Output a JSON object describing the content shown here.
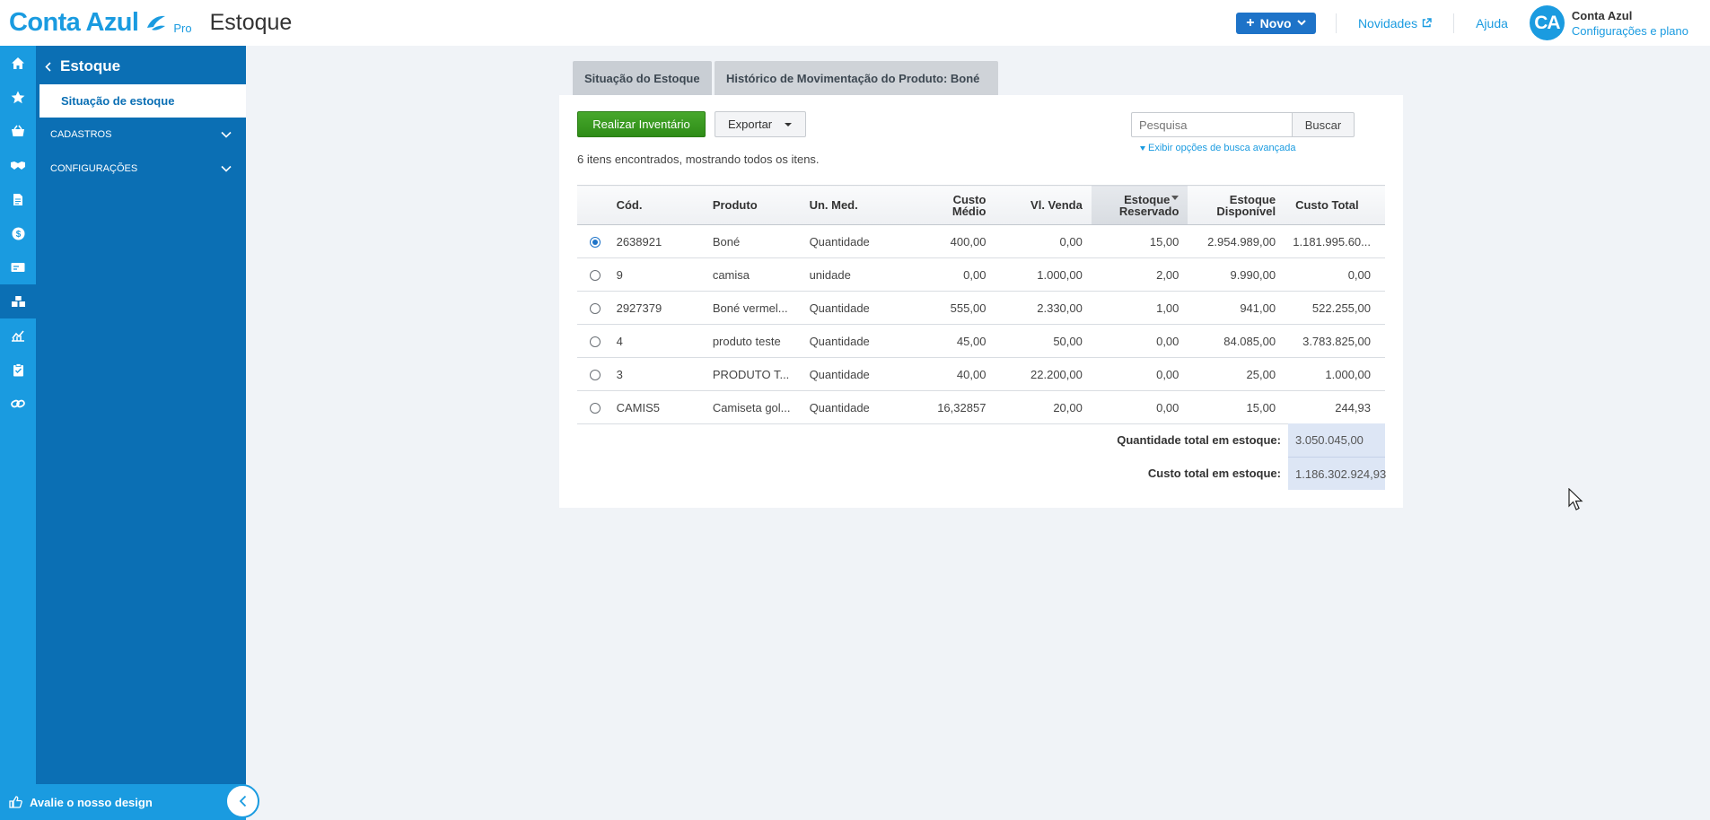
{
  "header": {
    "logo_text": "Conta Azul",
    "logo_badge": "Pro",
    "module_title": "Estoque",
    "novo_label": "Novo",
    "novidades_label": "Novidades",
    "ajuda_label": "Ajuda",
    "user_initials": "CA",
    "user_name": "Conta Azul",
    "user_plan": "Configurações e plano"
  },
  "rail": {
    "items": [
      "home-icon",
      "star-icon",
      "basket-icon",
      "handshake-icon",
      "document-icon",
      "dollar-icon",
      "card-icon",
      "inventory-icon",
      "chart-icon",
      "clipboard-icon",
      "link-icon"
    ],
    "active_index": 7
  },
  "sidebar": {
    "title": "Estoque",
    "active_item": "Situação de estoque",
    "sections": [
      "CADASTROS",
      "CONFIGURAÇÕES"
    ],
    "footer_label": "Avalie o nosso design"
  },
  "tabs": [
    {
      "label": "Situação do Estoque"
    },
    {
      "label": "Histórico de Movimentação do Produto: Boné"
    }
  ],
  "toolbar": {
    "inventario_label": "Realizar Inventário",
    "exportar_label": "Exportar",
    "search_placeholder": "Pesquisa",
    "search_button": "Buscar",
    "advanced_search": "Exibir opções de busca avançada",
    "count_text": "6 itens encontrados, mostrando todos os itens."
  },
  "table": {
    "columns": [
      {
        "line1": "Cód.",
        "line2": ""
      },
      {
        "line1": "Produto",
        "line2": ""
      },
      {
        "line1": "Un. Med.",
        "line2": ""
      },
      {
        "line1": "Custo",
        "line2": "Médio"
      },
      {
        "line1": "Vl. Venda",
        "line2": ""
      },
      {
        "line1": "Estoque",
        "line2": "Reservado"
      },
      {
        "line1": "Estoque",
        "line2": "Disponível"
      },
      {
        "line1": "Custo Total",
        "line2": ""
      }
    ],
    "rows": [
      {
        "selected": true,
        "cod": "2638921",
        "produto": "Boné",
        "un": "Quantidade",
        "custo_medio": "400,00",
        "vl_venda": "0,00",
        "reservado": "15,00",
        "disponivel": "2.954.989,00",
        "custo_total": "1.181.995.60..."
      },
      {
        "selected": false,
        "cod": "9",
        "produto": "camisa",
        "un": "unidade",
        "custo_medio": "0,00",
        "vl_venda": "1.000,00",
        "reservado": "2,00",
        "disponivel": "9.990,00",
        "custo_total": "0,00"
      },
      {
        "selected": false,
        "cod": "2927379",
        "produto": "Boné vermel...",
        "un": "Quantidade",
        "custo_medio": "555,00",
        "vl_venda": "2.330,00",
        "reservado": "1,00",
        "disponivel": "941,00",
        "custo_total": "522.255,00"
      },
      {
        "selected": false,
        "cod": "4",
        "produto": "produto teste",
        "un": "Quantidade",
        "custo_medio": "45,00",
        "vl_venda": "50,00",
        "reservado": "0,00",
        "disponivel": "84.085,00",
        "custo_total": "3.783.825,00"
      },
      {
        "selected": false,
        "cod": "3",
        "produto": "PRODUTO T...",
        "un": "Quantidade",
        "custo_medio": "40,00",
        "vl_venda": "22.200,00",
        "reservado": "0,00",
        "disponivel": "25,00",
        "custo_total": "1.000,00"
      },
      {
        "selected": false,
        "cod": "CAMIS5",
        "produto": "Camiseta gol...",
        "un": "Quantidade",
        "custo_medio": "16,32857",
        "vl_venda": "20,00",
        "reservado": "0,00",
        "disponivel": "15,00",
        "custo_total": "244,93"
      }
    ]
  },
  "totals": {
    "quantidade_label": "Quantidade total em estoque:",
    "quantidade_value": "3.050.045,00",
    "custo_label": "Custo total em estoque:",
    "custo_value": "1.186.302.924,93"
  },
  "colors": {
    "brand_blue": "#1a9be0",
    "sidebar_blue": "#0b6fb4",
    "primary_button": "#1e73c8",
    "success_green": "#3a9a22"
  }
}
